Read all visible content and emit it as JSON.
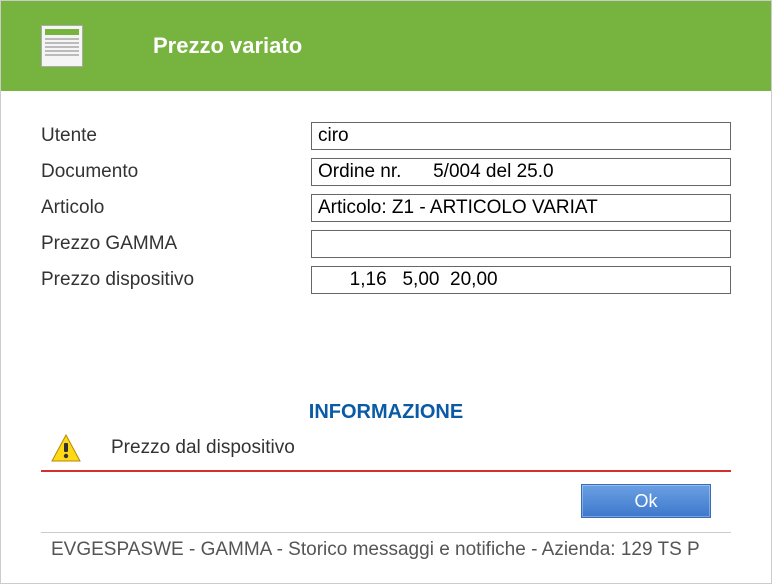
{
  "header": {
    "title": "Prezzo variato"
  },
  "form": {
    "labels": {
      "utente": "Utente",
      "documento": "Documento",
      "articolo": "Articolo",
      "prezzo_gamma": "Prezzo GAMMA",
      "prezzo_dispositivo": "Prezzo dispositivo"
    },
    "values": {
      "utente": "ciro",
      "documento": "Ordine nr.      5/004 del 25.0",
      "articolo": "Articolo: Z1 - ARTICOLO VARIAT",
      "prezzo_gamma": "",
      "prezzo_dispositivo": "      1,16   5,00  20,00"
    }
  },
  "info": {
    "heading": "INFORMAZIONE",
    "message": "Prezzo dal dispositivo"
  },
  "buttons": {
    "ok": "Ok"
  },
  "statusbar": {
    "text": "EVGESPASWE - GAMMA - Storico messaggi e notifiche - Azienda:  129 TS P"
  }
}
